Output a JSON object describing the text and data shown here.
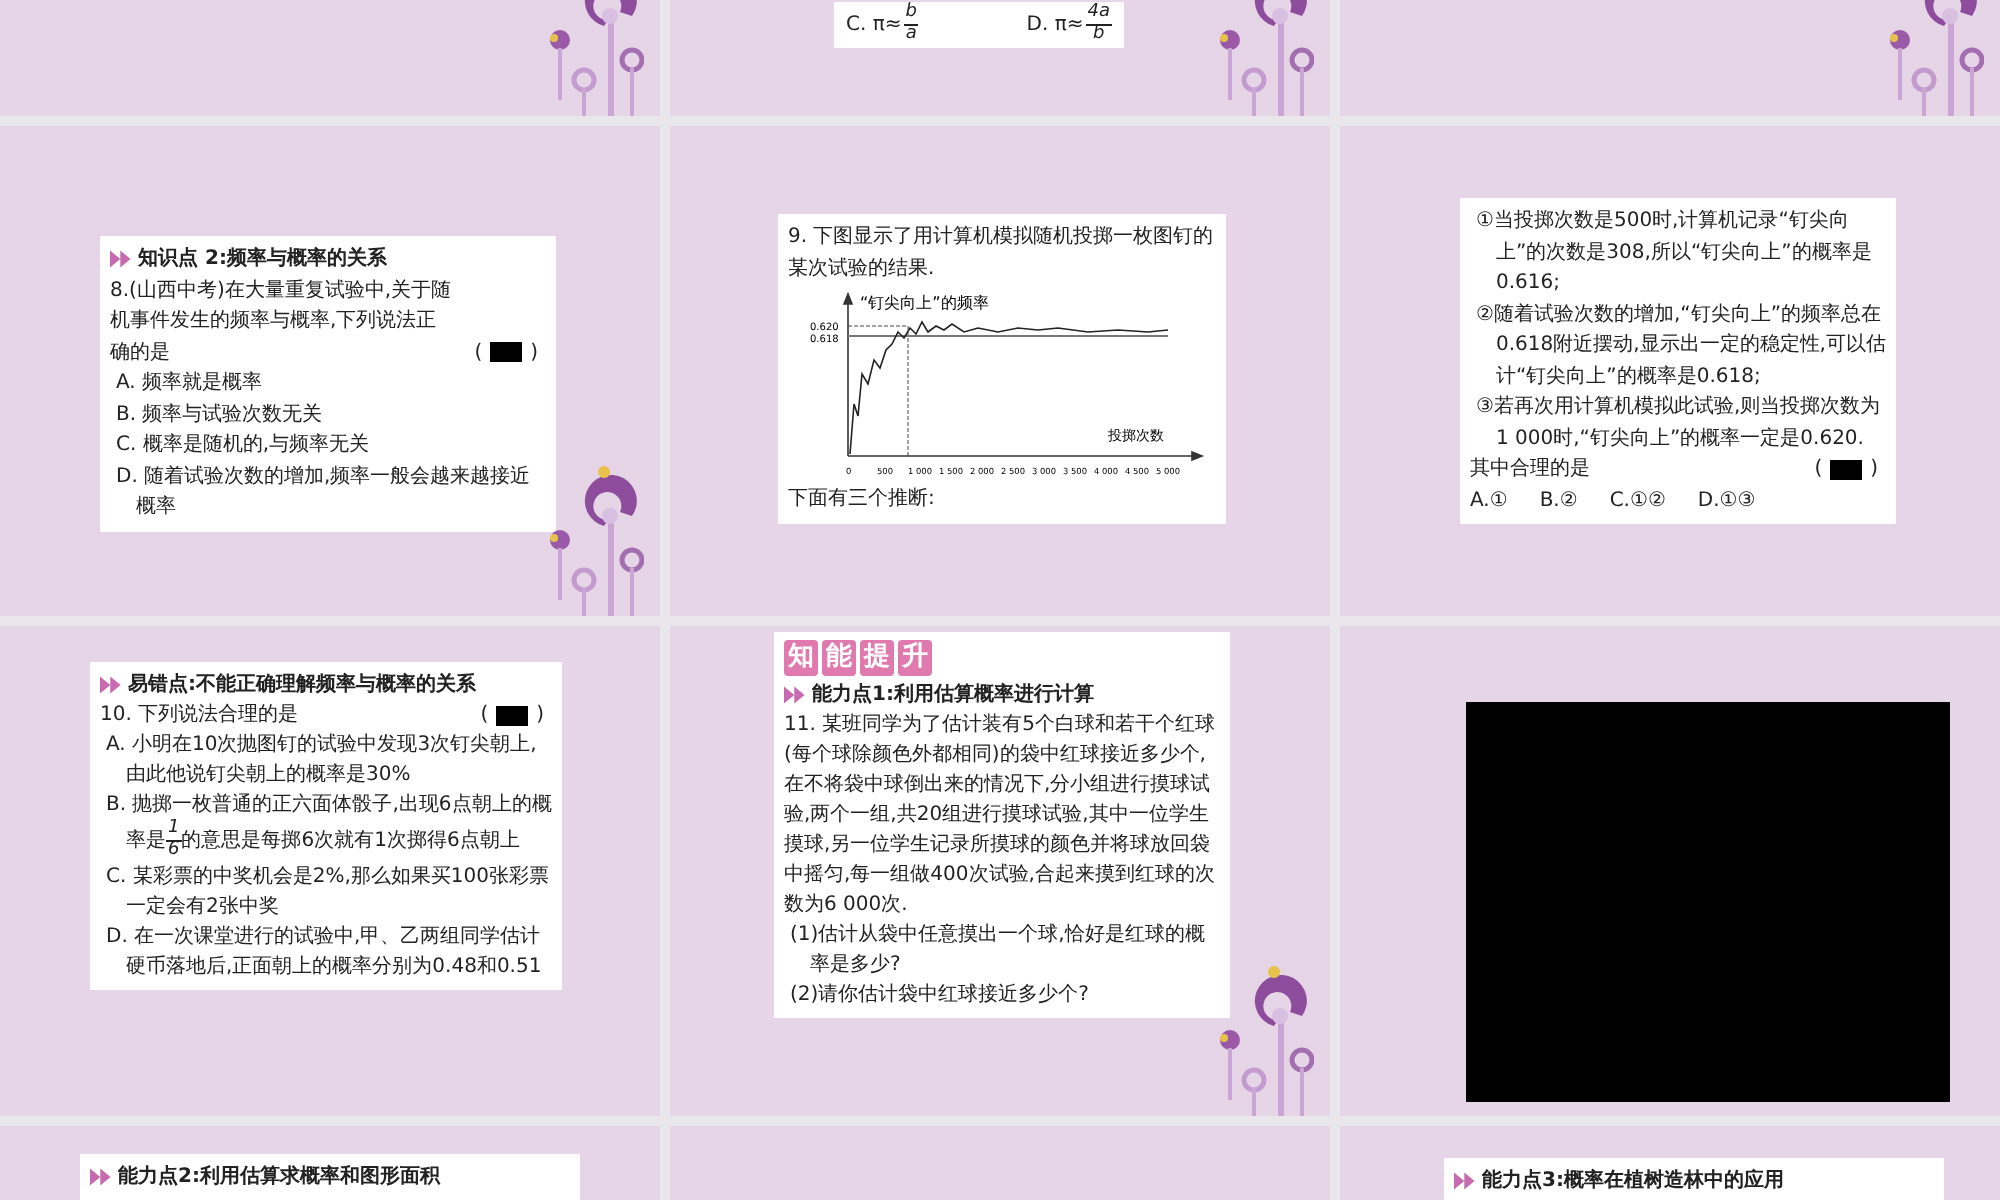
{
  "slides": [
    {
      "kind": "blank",
      "decorated": true
    },
    {
      "kind": "question",
      "decorated": true,
      "blocks": [
        {
          "kind": "choices",
          "items": [
            {
              "before": "C. π≈",
              "num": "b",
              "den": "a"
            },
            {
              "before": "D. π≈",
              "num": "4a",
              "den": "b"
            }
          ]
        }
      ]
    },
    {
      "kind": "blank",
      "decorated": true
    },
    {
      "kind": "question",
      "decorated": true,
      "blocks": [
        {
          "kind": "heading",
          "text": "知识点 2:频率与概率的关系"
        },
        {
          "kind": "question",
          "text": "8.(山西中考)在大量重复试验中,关于随机事件发生的频率与概率,下列说法正确的是",
          "answer": {
            "open": "(",
            "close": ")"
          }
        },
        {
          "kind": "option",
          "text": "A. 频率就是概率"
        },
        {
          "kind": "option",
          "text": "B. 频率与试验次数无关"
        },
        {
          "kind": "option",
          "text": "C. 概率是随机的,与频率无关"
        },
        {
          "kind": "option",
          "text": "D. 随着试验次数的增加,频率一般会越来越接近概率"
        }
      ]
    },
    {
      "kind": "question",
      "decorated": false,
      "blocks": [
        {
          "kind": "question",
          "text": "9. 下图显示了用计算机模拟随机投掷一枚图钉的某次试验的结果."
        },
        {
          "kind": "chart",
          "ylabel": "“钉尖向上”的频率",
          "xlabel": "投掷次数",
          "yticks": [
            "0.620",
            "0.618"
          ],
          "xticks": [
            "0",
            "500",
            "1 000",
            "1 500",
            "2 000",
            "2 500",
            "3 000",
            "3 500",
            "4 000",
            "4 500",
            "5 000"
          ]
        },
        {
          "kind": "para",
          "text": "下面有三个推断:"
        }
      ]
    },
    {
      "kind": "question",
      "decorated": false,
      "blocks": [
        {
          "kind": "option",
          "text": "①当投掷次数是500时,计算机记录“钉尖向上”的次数是308,所以“钉尖向上”的概率是0.616;"
        },
        {
          "kind": "option",
          "text": "②随着试验次数的增加,“钉尖向上”的频率总在0.618附近摆动,显示出一定的稳定性,可以估计“钉尖向上”的概率是0.618;"
        },
        {
          "kind": "option",
          "text": "③若再次用计算机模拟此试验,则当投掷次数为1 000时,“钉尖向上”的概率一定是0.620."
        },
        {
          "kind": "question",
          "text": "其中合理的是",
          "answer": {
            "open": "(",
            "close": ")"
          }
        },
        {
          "kind": "choices",
          "items": [
            {
              "before": "A.①"
            },
            {
              "before": "B.②"
            },
            {
              "before": "C.①②"
            },
            {
              "before": "D.①③"
            }
          ]
        }
      ]
    },
    {
      "kind": "question",
      "decorated": false,
      "blocks": [
        {
          "kind": "heading",
          "text": "易错点:不能正确理解频率与概率的关系"
        },
        {
          "kind": "question",
          "text": "10. 下列说法合理的是",
          "answer": {
            "open": "(",
            "close": ")"
          }
        },
        {
          "kind": "option",
          "text": "A. 小明在10次抛图钉的试验中发现3次钉尖朝上,由此他说钉尖朝上的概率是30%"
        },
        {
          "kind": "fraction",
          "before": "B. 抛掷一枚普通的正六面体骰子,出现6点朝上的概率是",
          "num": "1",
          "den": "6",
          "after": "的意思是每掷6次就有1次掷得6点朝上"
        },
        {
          "kind": "option",
          "text": "C. 某彩票的中奖机会是2%,那么如果买100张彩票一定会有2张中奖"
        },
        {
          "kind": "option",
          "text": "D. 在一次课堂进行的试验中,甲、乙两组同学估计硬币落地后,正面朝上的概率分别为0.48和0.51"
        }
      ]
    },
    {
      "kind": "question",
      "decorated": true,
      "blocks": [
        {
          "kind": "banner",
          "text": "知能提升"
        },
        {
          "kind": "heading",
          "text": "能力点1:利用估算概率进行计算"
        },
        {
          "kind": "question",
          "text": "11. 某班同学为了估计装有5个白球和若干个红球(每个球除颜色外都相同)的袋中红球接近多少个,在不将袋中球倒出来的情况下,分小组进行摸球试验,两个一组,共20组进行摸球试验,其中一位学生摸球,另一位学生记录所摸球的颜色并将球放回袋中摇匀,每一组做400次试验,合起来摸到红球的次数为6 000次."
        },
        {
          "kind": "option",
          "text": "(1)估计从袋中任意摸出一个球,恰好是红球的概率是多少?"
        },
        {
          "kind": "option",
          "text": "(2)请你估计袋中红球接近多少个?"
        }
      ]
    },
    {
      "kind": "video",
      "decorated": false
    },
    {
      "kind": "question",
      "decorated": false,
      "blocks": [
        {
          "kind": "heading",
          "text": "能力点2:利用估算求概率和图形面积"
        }
      ]
    },
    {
      "kind": "blank",
      "decorated": false
    },
    {
      "kind": "question",
      "decorated": false,
      "blocks": [
        {
          "kind": "heading",
          "text": "能力点3:概率在植树造林中的应用"
        }
      ]
    }
  ]
}
